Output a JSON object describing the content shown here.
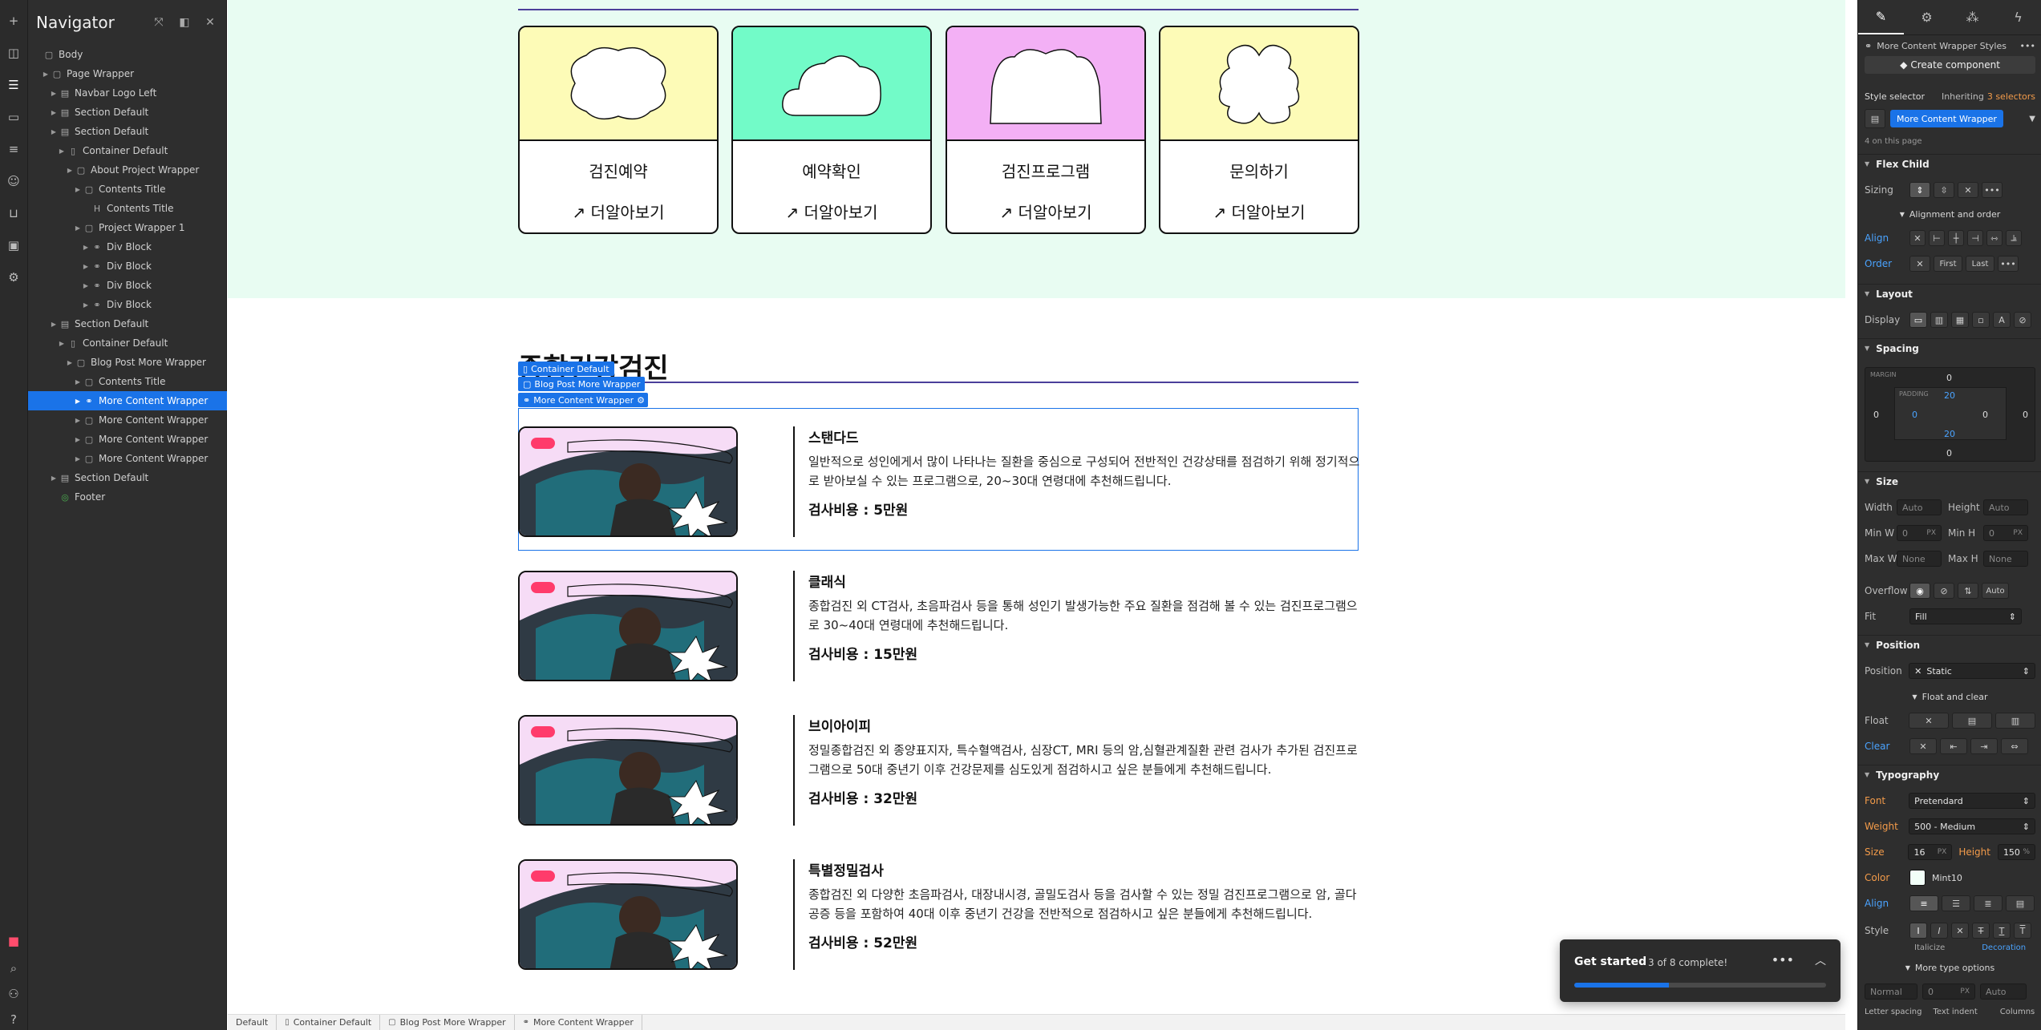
{
  "navigator": {
    "title": "Navigator",
    "tree": [
      {
        "label": "Body",
        "depth": 0,
        "icon": "box",
        "selected": false,
        "twisty": false
      },
      {
        "label": "Page Wrapper",
        "depth": 1,
        "icon": "box",
        "selected": false,
        "twisty": true
      },
      {
        "label": "Navbar Logo Left",
        "depth": 2,
        "icon": "section",
        "selected": false,
        "twisty": true
      },
      {
        "label": "Section Default",
        "depth": 2,
        "icon": "section",
        "selected": false,
        "twisty": true
      },
      {
        "label": "Section Default",
        "depth": 2,
        "icon": "section",
        "selected": false,
        "twisty": true
      },
      {
        "label": "Container Default",
        "depth": 3,
        "icon": "container",
        "selected": false,
        "twisty": true
      },
      {
        "label": "About Project Wrapper",
        "depth": 4,
        "icon": "box",
        "selected": false,
        "twisty": true
      },
      {
        "label": "Contents Title",
        "depth": 5,
        "icon": "box",
        "selected": false,
        "twisty": true
      },
      {
        "label": "Contents Title",
        "depth": 6,
        "icon": "heading",
        "selected": false,
        "twisty": false
      },
      {
        "label": "Project Wrapper 1",
        "depth": 5,
        "icon": "box",
        "selected": false,
        "twisty": true
      },
      {
        "label": "Div Block",
        "depth": 6,
        "icon": "link",
        "selected": false,
        "twisty": true
      },
      {
        "label": "Div Block",
        "depth": 6,
        "icon": "link",
        "selected": false,
        "twisty": true
      },
      {
        "label": "Div Block",
        "depth": 6,
        "icon": "link",
        "selected": false,
        "twisty": true
      },
      {
        "label": "Div Block",
        "depth": 6,
        "icon": "link",
        "selected": false,
        "twisty": true
      },
      {
        "label": "Section Default",
        "depth": 2,
        "icon": "section",
        "selected": false,
        "twisty": true
      },
      {
        "label": "Container Default",
        "depth": 3,
        "icon": "container",
        "selected": false,
        "twisty": true
      },
      {
        "label": "Blog Post More Wrapper",
        "depth": 4,
        "icon": "box",
        "selected": false,
        "twisty": true
      },
      {
        "label": "Contents Title",
        "depth": 5,
        "icon": "box",
        "selected": false,
        "twisty": true
      },
      {
        "label": "More Content Wrapper",
        "depth": 5,
        "icon": "link",
        "selected": true,
        "twisty": true
      },
      {
        "label": "More Content Wrapper",
        "depth": 5,
        "icon": "box",
        "selected": false,
        "twisty": true
      },
      {
        "label": "More Content Wrapper",
        "depth": 5,
        "icon": "box",
        "selected": false,
        "twisty": true
      },
      {
        "label": "More Content Wrapper",
        "depth": 5,
        "icon": "box",
        "selected": false,
        "twisty": true
      },
      {
        "label": "Section Default",
        "depth": 2,
        "icon": "section",
        "selected": false,
        "twisty": true
      },
      {
        "label": "Footer",
        "depth": 2,
        "icon": "symbol",
        "selected": false,
        "twisty": false
      }
    ]
  },
  "canvas": {
    "cards": [
      {
        "title": "검진예약",
        "more": "↗ 더알아보기",
        "bg": "#fdfbb7",
        "shape": "bubbles"
      },
      {
        "title": "예약확인",
        "more": "↗ 더알아보기",
        "bg": "#72fbc8",
        "shape": "cloud"
      },
      {
        "title": "검진프로그램",
        "more": "↗ 더알아보기",
        "bg": "#f3b0f5",
        "shape": "arch"
      },
      {
        "title": "문의하기",
        "more": "↗ 더알아보기",
        "bg": "#fdfbb7",
        "shape": "clover"
      }
    ],
    "section_title": "종합건강검진",
    "badges": {
      "container": "Container Default",
      "blog": "Blog Post More Wrapper",
      "more": "More Content Wrapper"
    },
    "programs": [
      {
        "name": "스탠다드",
        "desc": "일반적으로 성인에게서 많이 나타나는 질환을 중심으로 구성되어 전반적인 건강상태를 점검하기 위해 정기적으로 받아보실 수 있는 프로그램으로, 20~30대 연령대에 추천해드립니다.",
        "price": "검사비용 : 5만원"
      },
      {
        "name": "클래식",
        "desc": "종합검진 외 CT검사, 초음파검사 등을 통해 성인기 발생가능한 주요 질환을 점검해 볼 수 있는 검진프로그램으로 30~40대 연령대에 추천해드립니다.",
        "price": "검사비용 : 15만원"
      },
      {
        "name": "브이아이피",
        "desc": "정밀종합검진 외 종양표지자, 특수혈액검사, 심장CT, MRI 등의 암,심혈관계질환 관련 검사가 추가된 검진프로그램으로 50대 중년기 이후 건강문제를 심도있게 점검하시고 싶은 분들에게 추천해드립니다.",
        "price": "검사비용 : 32만원"
      },
      {
        "name": "특별정밀검사",
        "desc": "종합검진 외 다양한 초음파검사, 대장내시경, 골밀도검사 등을 검사할 수 있는 정밀 검진프로그램으로 암, 골다공증 등을 포함하여 40대 이후 중년기 건강을 전반적으로 점검하시고 싶은 분들에게 추천해드립니다.",
        "price": "검사비용 : 52만원"
      }
    ]
  },
  "breadcrumbs": [
    "Default",
    "Container Default",
    "Blog Post More Wrapper",
    "More Content Wrapper"
  ],
  "get_started": {
    "title": "Get started",
    "count": "3 of 8 complete!",
    "progress": 0.375
  },
  "style_panel": {
    "element_styles": "More Content Wrapper Styles",
    "create_component": "Create component",
    "style_selector": "Style selector",
    "inheriting": "Inheriting",
    "inheriting_count": "3 selectors",
    "selector_value": "More Content Wrapper",
    "on_page": "4 on this page",
    "flex_child": "Flex Child",
    "sizing": "Sizing",
    "alignment_order": "Alignment and order",
    "align": "Align",
    "order": "Order",
    "first": "First",
    "last": "Last",
    "layout": "Layout",
    "display": "Display",
    "spacing": "Spacing",
    "margin_label": "MARGIN",
    "padding_label": "PADDING",
    "margin": {
      "top": "0",
      "right": "0",
      "bottom": "0",
      "left": "0"
    },
    "padding": {
      "top": "20",
      "right": "0",
      "bottom": "20",
      "left": "0"
    },
    "size": "Size",
    "width": "Width",
    "height": "Height",
    "min_w": "Min W",
    "min_h": "Min H",
    "max_w": "Max W",
    "max_h": "Max H",
    "auto": "Auto",
    "none": "None",
    "zero": "0",
    "px": "PX",
    "overflow": "Overflow",
    "fit": "Fit",
    "fill": "Fill",
    "position": "Position",
    "position_label": "Position",
    "static": "Static",
    "float_clear": "Float and clear",
    "float": "Float",
    "clear": "Clear",
    "typography": "Typography",
    "font": "Font",
    "font_value": "Pretendard",
    "weight": "Weight",
    "weight_value": "500 - Medium",
    "size_label": "Size",
    "size_value": "16",
    "height_label": "Height",
    "height_value": "150",
    "height_unit": "%",
    "color": "Color",
    "color_value": "Mint10",
    "align_label": "Align",
    "style": "Style",
    "italicize": "Italicize",
    "decoration": "Decoration",
    "more_type": "More type options",
    "normal": "Normal",
    "letter_spacing": "Letter spacing",
    "text_indent": "Text indent",
    "columns": "Columns"
  }
}
